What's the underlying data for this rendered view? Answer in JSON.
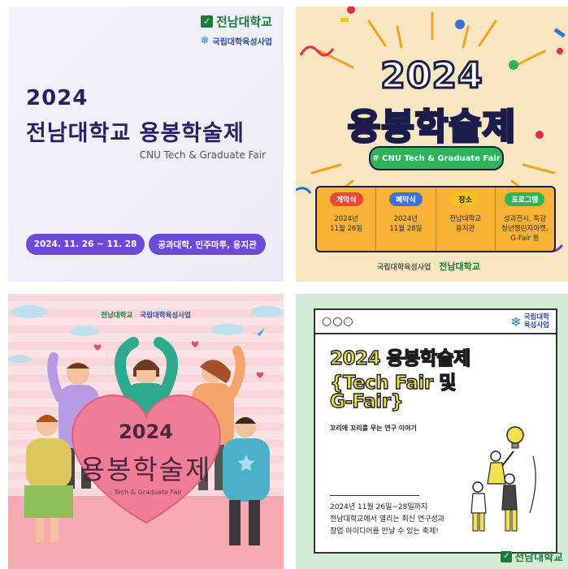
{
  "card1": {
    "university": "전남대학교",
    "program": "국립대학육성사업",
    "year": "2024",
    "title": "전남대학교 용봉학술제",
    "subtitle": "CNU Tech & Graduate Fair",
    "date_pill": "2024. 11. 26 ~ 11. 28",
    "venue_pill": "공과대학, 민주마루, 용지관",
    "accent_color": "#6a4ad6"
  },
  "card2": {
    "year": "2024",
    "title": "용봉학술제",
    "tag": "# CNU Tech & Graduate Fair",
    "columns": [
      {
        "label": "개막식",
        "value": "2024년\n11월 26일",
        "color": "#e8473a"
      },
      {
        "label": "폐막식",
        "value": "2024년\n11월 28일",
        "color": "#3a72d8"
      },
      {
        "label": "장소",
        "value": "전남대학교\n용지관",
        "color": "#f2c318"
      },
      {
        "label": "프로그램",
        "value": "성과전시, 특강\n청년챌린지마켓,\nG-Fair 등",
        "color": "#2fb35a"
      }
    ],
    "footer_program": "국립대학육성사업",
    "footer_university": "전남대학교"
  },
  "card3": {
    "university": "전남대학교",
    "program": "국립대학육성사업",
    "year": "2024",
    "title": "용봉학술제",
    "subtitle": ": Tech & Graduate Fair"
  },
  "card4": {
    "dots": "○○○",
    "program_line1": "국립대학",
    "program_line2": "육성사업",
    "title_line1": "2024 용봉학술제",
    "title_line2": "{Tech Fair 및",
    "title_line3": "G-Fair}",
    "tagline": "꼬리에 꼬리를 무는 연구 이야기",
    "desc_line1": "2024년 11월 26일~28일까지",
    "desc_line2": "전남대학교에서 열리는 최신 연구성과",
    "desc_line3": "창업 아이디어를 만날 수 있는 축제!",
    "university": "전남대학교"
  }
}
